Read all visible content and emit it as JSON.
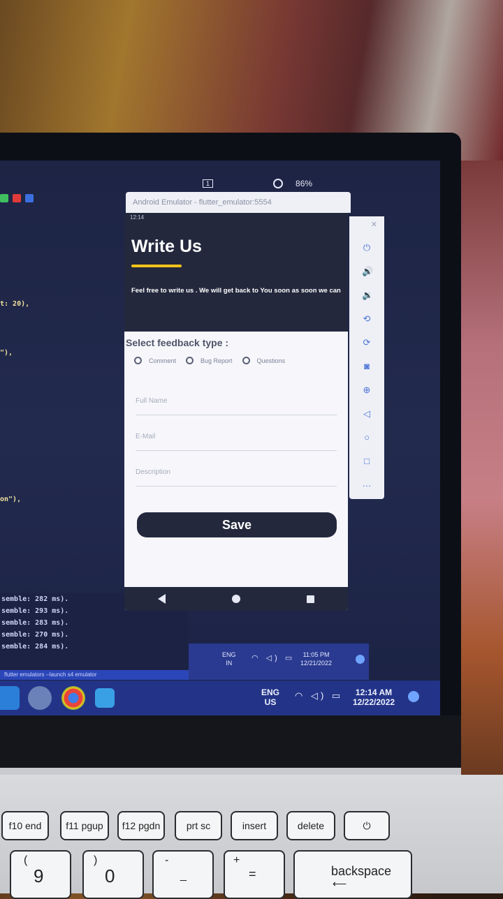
{
  "emulator": {
    "title": "Android Emulator - flutter_emulator:5554",
    "zoom_pct": "86%",
    "top_box": "1"
  },
  "app": {
    "status_time": "12:14",
    "title": "Write Us",
    "subtitle": "Feel free  to write us . We will get back  to You soon as soon we can",
    "feedback_label": "Select feedback  type :",
    "radio_options": [
      "Comment",
      "Bug Report",
      "Questions"
    ],
    "fields": {
      "full_name": "Full Name",
      "email": "E-Mail",
      "description": "Description"
    },
    "save_label": "Save"
  },
  "code": {
    "lines": [
      "t: 20),",
      "\"),",
      "on\"),"
    ]
  },
  "log": {
    "lines": [
      "semble: 282 ms).",
      "semble: 293 ms).",
      "semble: 283 ms).",
      "semble: 270 ms).",
      "semble: 284 ms)."
    ],
    "status_strip": "flutter emulators --launch s4 emulator"
  },
  "inner_taskbar": {
    "lang": "ENG",
    "region": "IN",
    "time": "11:05 PM",
    "date": "12/21/2022"
  },
  "taskbar": {
    "lang": "ENG",
    "region": "US",
    "time": "12:14 AM",
    "date": "12/22/2022"
  },
  "keyboard": {
    "f10": "f10 end",
    "f11": "f11 pgup",
    "f12": "f12 pgdn",
    "prtsc": "prt sc",
    "insert": "insert",
    "delete": "delete",
    "key9": "9",
    "key9_shift": "(",
    "key0": "0",
    "key0_shift": ")",
    "minus": "-",
    "minus_shift": "_",
    "equals": "=",
    "equals_shift": "+",
    "backspace": "backspace"
  }
}
